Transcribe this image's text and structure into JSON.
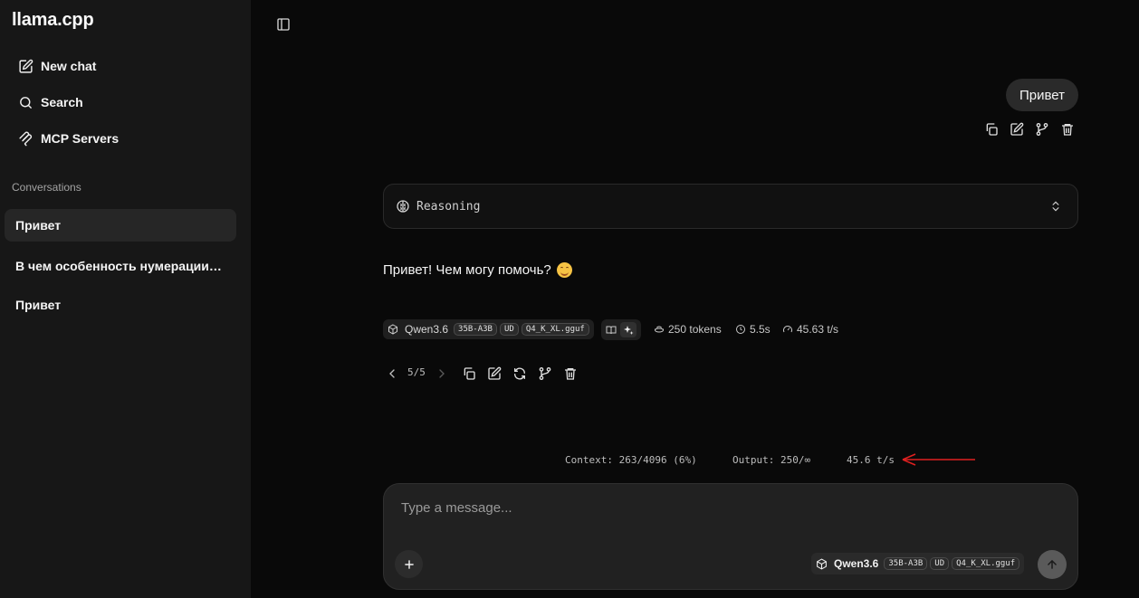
{
  "app": {
    "title": "llama.cpp"
  },
  "sidebar": {
    "nav": [
      {
        "label": "New chat",
        "icon": "edit-icon"
      },
      {
        "label": "Search",
        "icon": "search-icon"
      },
      {
        "label": "MCP Servers",
        "icon": "mcp-icon"
      }
    ],
    "section_label": "Conversations",
    "conversations": [
      {
        "title": "Привет",
        "active": true
      },
      {
        "title": "В чем особенность нумерации г...",
        "active": false
      },
      {
        "title": "Привет",
        "active": false
      }
    ]
  },
  "chat": {
    "user_message": "Привет",
    "reasoning_label": "Reasoning",
    "assistant_message": "Привет! Чем могу помочь?",
    "model": {
      "name": "Qwen3.6",
      "tags": [
        "35B-A3B",
        "UD",
        "Q4_K_XL.gguf"
      ]
    },
    "stats": {
      "tokens": "250 tokens",
      "time": "5.5s",
      "speed": "45.63 t/s"
    },
    "pager": "5/5"
  },
  "status_bar": {
    "context": "Context: 263/4096 (6%)",
    "output": "Output: 250/∞",
    "speed": "45.6 t/s",
    "arrow_color": "#e02020"
  },
  "composer": {
    "placeholder": "Type a message...",
    "value": "",
    "model": {
      "name": "Qwen3.6",
      "tags": [
        "35B-A3B",
        "UD",
        "Q4_K_XL.gguf"
      ]
    }
  }
}
